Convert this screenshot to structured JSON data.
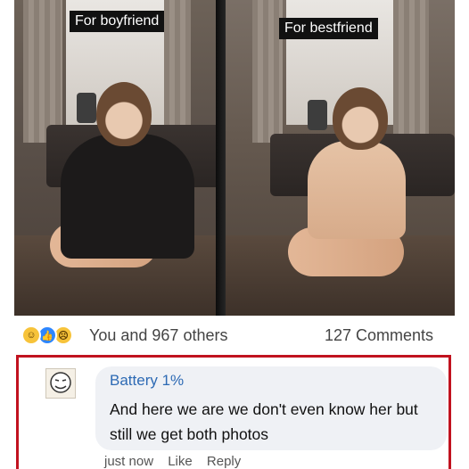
{
  "photos": {
    "left_caption": "For boyfriend",
    "right_caption": "For bestfriend"
  },
  "reactions": {
    "icons": [
      "haha-icon",
      "like-icon",
      "sad-icon"
    ],
    "summary": "You and 967 others",
    "comments": "127 Comments"
  },
  "comment": {
    "author": "Battery 1%",
    "text": "And here we are we don't even know her but still we get both photos",
    "time": "just now",
    "like_label": "Like",
    "reply_label": "Reply"
  },
  "colors": {
    "accent_border": "#c1121f",
    "author_link": "#2d6ab4",
    "like_blue": "#2d86ff"
  }
}
